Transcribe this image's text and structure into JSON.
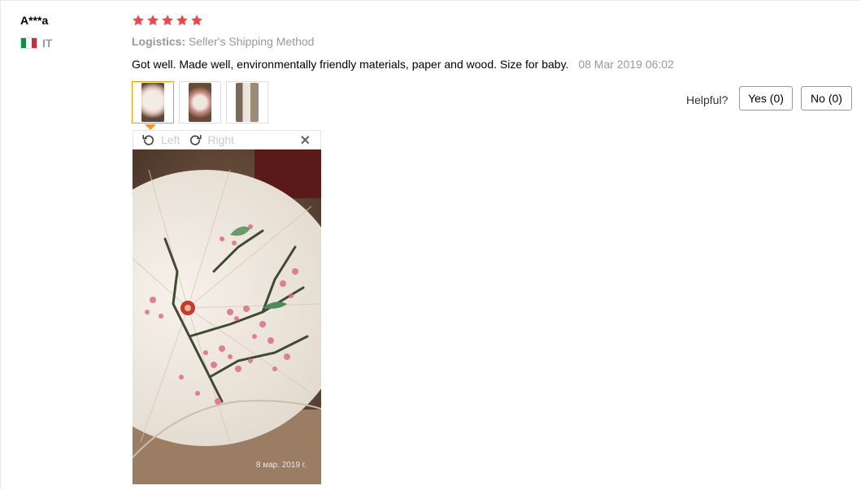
{
  "reviewer": {
    "name": "A***a",
    "country_code": "IT",
    "flag_colors": [
      "#009246",
      "#ffffff",
      "#ce2b37"
    ]
  },
  "review": {
    "rating": 5,
    "max_rating": 5,
    "star_color": "#f04848",
    "logistics_label": "Logistics:",
    "logistics_value": "Seller's Shipping Method",
    "text": "Got well. Made well, environmentally friendly materials, paper and wood. Size for baby.",
    "date": "08 Mar 2019 06:02"
  },
  "images": {
    "thumbnail_count": 3,
    "selected_index": 0,
    "accent_color": "#ff9900"
  },
  "viewer": {
    "rotate_left_label": "Left",
    "rotate_right_label": "Right",
    "close_icon": "close-icon",
    "photo_stamp": "8 мар. 2019 г."
  },
  "feedback": {
    "helpful_label": "Helpful?",
    "yes_label": "Yes (0)",
    "no_label": "No (0)"
  }
}
